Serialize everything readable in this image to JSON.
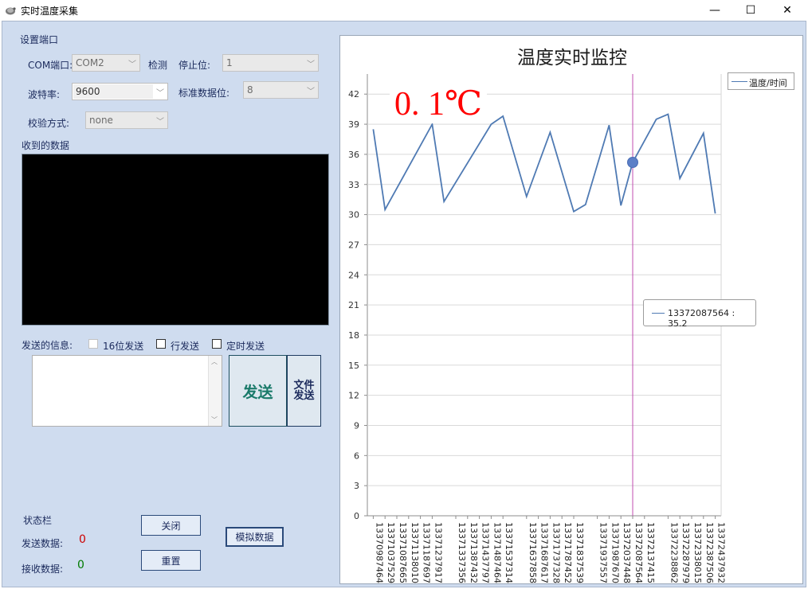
{
  "window": {
    "title": "实时温度采集",
    "minimize": "—",
    "maximize": "☐",
    "close": "✕"
  },
  "port_settings": {
    "section_label": "设置端口",
    "com_label": "COM端口:",
    "com_value": "COM2",
    "detect_label": "检测",
    "stop_bits_label": "停止位:",
    "stop_bits_value": "1",
    "baud_label": "波特率:",
    "baud_value": "9600",
    "data_bits_label": "标准数据位:",
    "data_bits_value": "8",
    "parity_label": "校验方式:",
    "parity_value": "none"
  },
  "receive": {
    "label": "收到的数据"
  },
  "send": {
    "label": "发送的信息:",
    "hex_label": "16位发送",
    "line_label": "行发送",
    "timed_label": "定时发送",
    "send_button": "发送",
    "file_button": "文件发送"
  },
  "status": {
    "label": "状态栏",
    "sent_label": "发送数据:",
    "sent_count": "0",
    "recv_label": "接收数据:",
    "recv_count": "0",
    "close_button": "关闭",
    "reset_button": "重置",
    "simulate_button": "模拟数据"
  },
  "colors": {
    "series": "#4f7ab3",
    "cursor": "#c04db0",
    "temp": "#ff0000",
    "sent": "#cc0000",
    "recv": "#007a00"
  },
  "chart_data": {
    "type": "line",
    "title": "温度实时监控",
    "current_reading": "0. 1℃",
    "legend": "温度/时间",
    "legend_placement": "top-right",
    "tooltip": "13372087564 : 35.2",
    "ylim": [
      0,
      44
    ],
    "yticks": [
      0,
      3,
      6,
      9,
      12,
      15,
      18,
      21,
      24,
      27,
      30,
      33,
      36,
      39,
      42
    ],
    "grid": true,
    "cursor_index": 22,
    "x": [
      "13370987464",
      "",
      "13371037529",
      "",
      "13371087665",
      "",
      "13371138010",
      "",
      "13371187697",
      "",
      "13371237917",
      "",
      "",
      "13371337356",
      "",
      "13371387432",
      "",
      "13371437797",
      "",
      "13371487464",
      "",
      "13371537314",
      "",
      "",
      "13371637858",
      "",
      "13371687617",
      "",
      "13371737328",
      "",
      "13371787452",
      "",
      "13371837539",
      "",
      "",
      "13371937557",
      "",
      "13371987670",
      "",
      "13372037448",
      "",
      "13372087564",
      "",
      "13372137415",
      "",
      "",
      "13372238862",
      "",
      "13372287979",
      "",
      "13372338015",
      "",
      "13372387506",
      "",
      "13372437932"
    ],
    "series": [
      {
        "name": "温度/时间",
        "x_index": [
          0,
          1,
          5,
          6,
          10,
          11,
          13,
          15,
          17,
          18,
          20,
          21,
          22,
          24,
          25,
          26,
          28,
          29
        ],
        "values": [
          38.5,
          30.5,
          39.0,
          31.3,
          39.0,
          39.8,
          31.8,
          38.2,
          30.3,
          31.0,
          38.9,
          30.9,
          35.2,
          39.5,
          40.0,
          33.6,
          38.1,
          30.1
        ]
      }
    ],
    "xlabels": [
      "13370987464",
      "13371037529",
      "13371087665",
      "13371138010",
      "13371187697",
      "13371237917",
      "13371337356",
      "13371387432",
      "13371437797",
      "13371487464",
      "13371537314",
      "13371637858",
      "13371687617",
      "13371737328",
      "13371787452",
      "13371837539",
      "13371937557",
      "13371987670",
      "13372037448",
      "13372087564",
      "13372137415",
      "13372238862",
      "13372287979",
      "13372338015",
      "13372387506",
      "13372437932"
    ],
    "xlabel_index": [
      0,
      1,
      2,
      3,
      4,
      5,
      7,
      8,
      9,
      10,
      11,
      13,
      14,
      15,
      16,
      17,
      19,
      20,
      21,
      22,
      23,
      25,
      26,
      27,
      28,
      29
    ]
  }
}
